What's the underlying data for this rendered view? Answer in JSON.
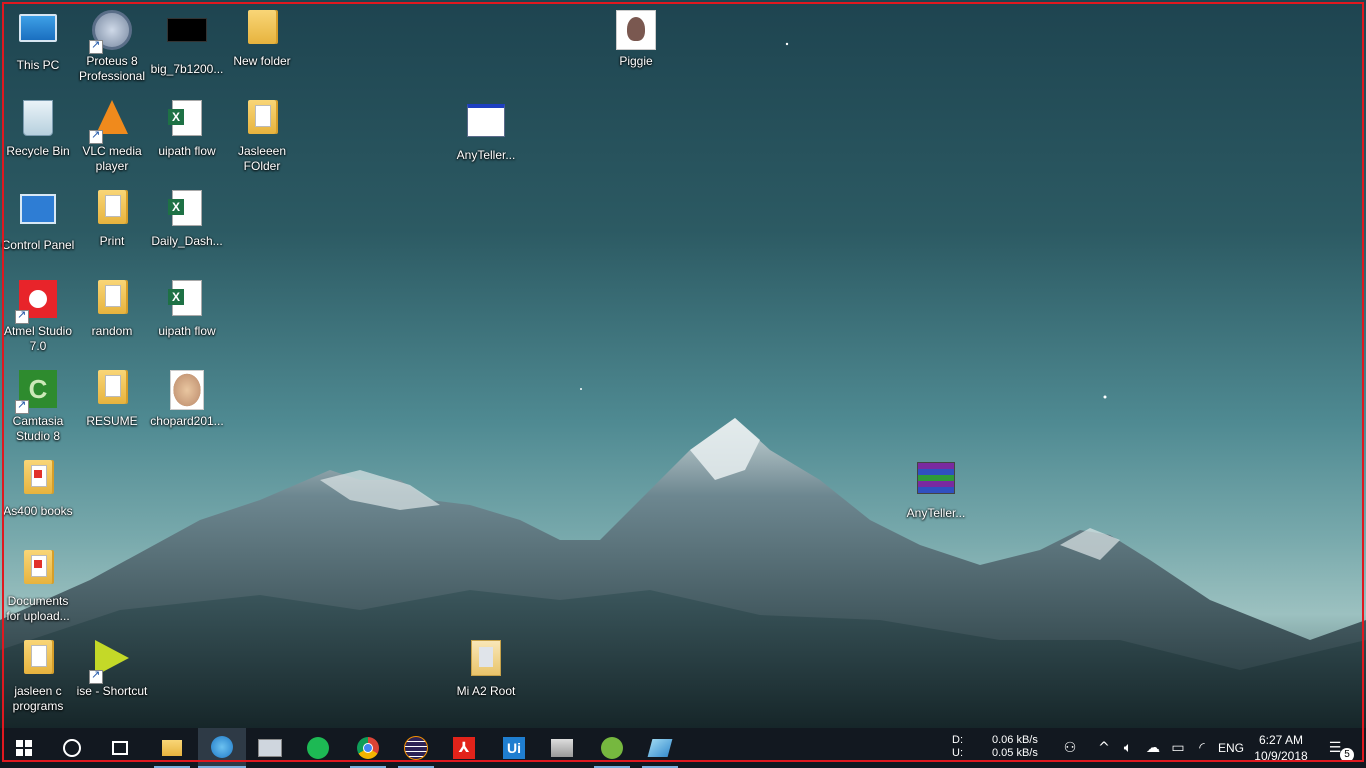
{
  "desktop": {
    "icons": [
      {
        "label": "This PC"
      },
      {
        "label": "Proteus 8 Professional"
      },
      {
        "label": "big_7b1200..."
      },
      {
        "label": "New folder"
      },
      {
        "label": "Piggie"
      },
      {
        "label": "Recycle Bin"
      },
      {
        "label": "VLC media player"
      },
      {
        "label": "uipath flow"
      },
      {
        "label": "Jasleeen FOlder"
      },
      {
        "label": "AnyTeller..."
      },
      {
        "label": "Control Panel"
      },
      {
        "label": "Print"
      },
      {
        "label": "Daily_Dash..."
      },
      {
        "label": "Atmel Studio 7.0"
      },
      {
        "label": "random"
      },
      {
        "label": "uipath flow"
      },
      {
        "label": "Camtasia Studio 8"
      },
      {
        "label": "RESUME"
      },
      {
        "label": "chopard201..."
      },
      {
        "label": "AnyTeller..."
      },
      {
        "label": "As400 books"
      },
      {
        "label": "Documents for upload..."
      },
      {
        "label": "jasleen c programs"
      },
      {
        "label": "ise - Shortcut"
      },
      {
        "label": "Mi A2 Root"
      }
    ]
  },
  "taskbar": {
    "start": {
      "icon": "windows-logo-icon"
    },
    "search": {
      "icon": "cortana-circle-icon"
    },
    "task_view": {
      "icon": "task-view-icon"
    },
    "pinned": [
      {
        "icon": "file-explorer-icon"
      },
      {
        "icon": "internet-download-manager-icon"
      },
      {
        "icon": "remote-desktop-icon"
      },
      {
        "icon": "spotify-icon"
      },
      {
        "icon": "chrome-icon"
      },
      {
        "icon": "eclipse-icon"
      },
      {
        "icon": "acrobat-icon",
        "text": "⅄"
      },
      {
        "icon": "uipath-icon",
        "text": "Ui"
      },
      {
        "icon": "network-tool-icon"
      },
      {
        "icon": "utorrent-icon"
      },
      {
        "icon": "snipping-tool-icon"
      }
    ],
    "netspeed": {
      "download_label": "D:",
      "download_value": "0.06 kB/s",
      "upload_label": "U:",
      "upload_value": "0.05 kB/s"
    },
    "tray": {
      "language": "ENG",
      "time": "6:27 AM",
      "date": "10/9/2018",
      "notification_count": "5"
    }
  }
}
